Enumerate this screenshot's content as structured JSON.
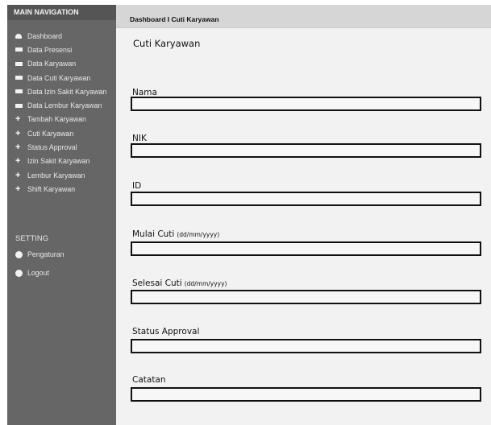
{
  "sidebar": {
    "header": "MAIN NAVIGATION",
    "items": [
      {
        "label": "Dashboard",
        "icon": "home-icon"
      },
      {
        "label": "Data Presensi",
        "icon": "rectangle-icon"
      },
      {
        "label": "Data Karyawan",
        "icon": "rectangle-icon"
      },
      {
        "label": "Data Cuti Karyawan",
        "icon": "rectangle-icon"
      },
      {
        "label": "Data Izin Sakit Karyawan",
        "icon": "rectangle-icon"
      },
      {
        "label": "Data Lembur Karyawan",
        "icon": "rectangle-icon"
      },
      {
        "label": "Tambah Karyawan",
        "icon": "plus-icon"
      },
      {
        "label": "Cuti Karyawan",
        "icon": "plus-icon"
      },
      {
        "label": "Status Approval",
        "icon": "plus-icon"
      },
      {
        "label": "Izin Sakit Karyawan",
        "icon": "plus-icon"
      },
      {
        "label": "Lembur Karyawan",
        "icon": "plus-icon"
      },
      {
        "label": "Shift Karyawan",
        "icon": "plus-icon"
      }
    ],
    "setting_header": "SETTING",
    "setting_items": [
      {
        "label": "Pengaturan",
        "icon": "circle-icon"
      },
      {
        "label": "Logout",
        "icon": "circle-icon"
      }
    ]
  },
  "main": {
    "breadcrumb": "Dashboard I Cuti Karyawan",
    "title": "Cuti Karyawan",
    "fields": [
      {
        "label": "Nama",
        "hint": "",
        "value": ""
      },
      {
        "label": "NIK",
        "hint": "",
        "value": ""
      },
      {
        "label": "ID",
        "hint": "",
        "value": ""
      },
      {
        "label": "Mulai Cuti",
        "hint": "(dd/mm/yyyy)",
        "value": ""
      },
      {
        "label": "Selesai Cuti",
        "hint": "(dd/mm/yyyy)",
        "value": ""
      },
      {
        "label": "Status Approval",
        "hint": "",
        "value": ""
      },
      {
        "label": "Catatan",
        "hint": "",
        "value": ""
      }
    ]
  }
}
